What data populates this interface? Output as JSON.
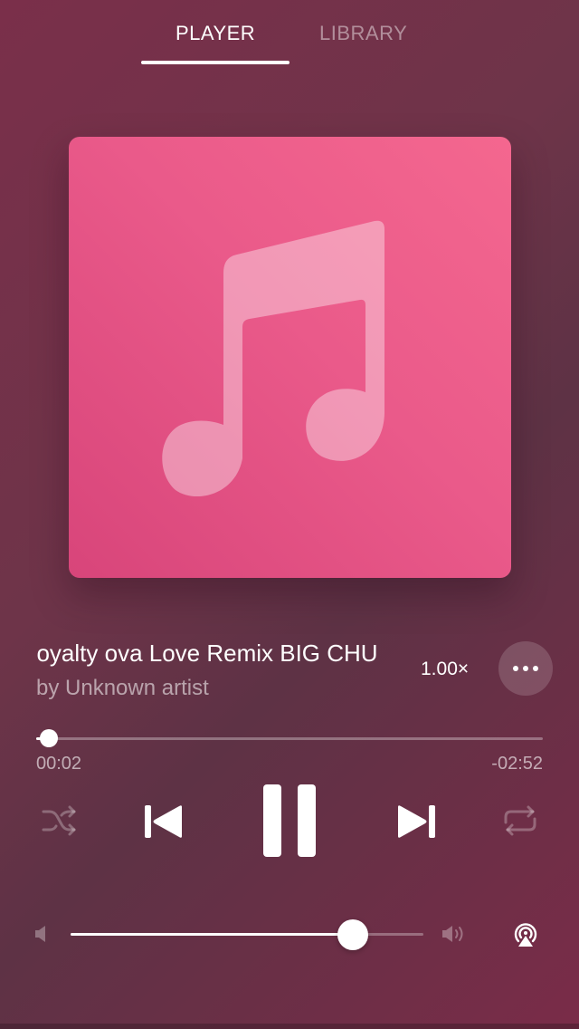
{
  "tabs": {
    "player": "PLAYER",
    "library": "LIBRARY"
  },
  "track": {
    "title": "Loyalty ova Love Remix BIG CHU",
    "artist": "by Unknown artist"
  },
  "playback": {
    "speed": "1.00×",
    "elapsed": "00:02",
    "remaining": "-02:52",
    "progress_fraction": 0.025,
    "state": "playing"
  },
  "volume": {
    "level_fraction": 0.8
  },
  "icons": {
    "artwork": "music-note-icon",
    "more": "more-dots-icon",
    "shuffle": "shuffle-icon",
    "previous": "previous-track-icon",
    "pause": "pause-icon",
    "next": "next-track-icon",
    "repeat": "repeat-icon",
    "volume_low": "volume-low-icon",
    "volume_high": "volume-high-icon",
    "airplay": "airplay-icon"
  },
  "colors": {
    "artwork_start": "#d8457a",
    "artwork_end": "#f4678f",
    "background": "#6e3449"
  }
}
